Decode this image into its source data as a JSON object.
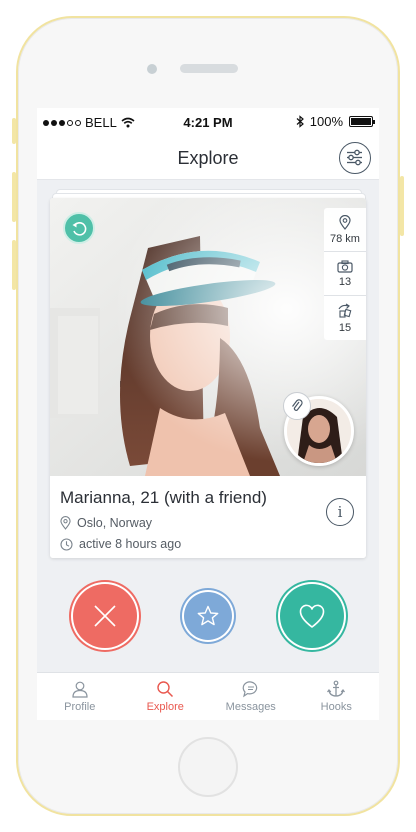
{
  "status_bar": {
    "carrier": "BELL",
    "time": "4:21 PM",
    "battery": "100%"
  },
  "nav": {
    "title": "Explore"
  },
  "profile_card": {
    "name_age": "Marianna, 21",
    "companion_note": "(with a friend)",
    "location": "Oslo, Norway",
    "last_active": "active 8 hours ago",
    "stats": {
      "distance": "78 km",
      "photos": "13",
      "mutual": "15"
    }
  },
  "actions": {
    "nope_icon": "x-icon",
    "star_icon": "star-icon",
    "like_icon": "heart-icon"
  },
  "tabs": [
    {
      "label": "Profile",
      "icon": "person-icon"
    },
    {
      "label": "Explore",
      "icon": "search-icon",
      "active": true
    },
    {
      "label": "Messages",
      "icon": "chat-icon"
    },
    {
      "label": "Hooks",
      "icon": "anchor-icon"
    }
  ],
  "colors": {
    "accent_red": "#ee6b63",
    "accent_teal": "#35b7a0",
    "accent_blue": "#7ea9d8",
    "active_tab": "#e9584f",
    "phone_trim": "#f1e3a0"
  }
}
